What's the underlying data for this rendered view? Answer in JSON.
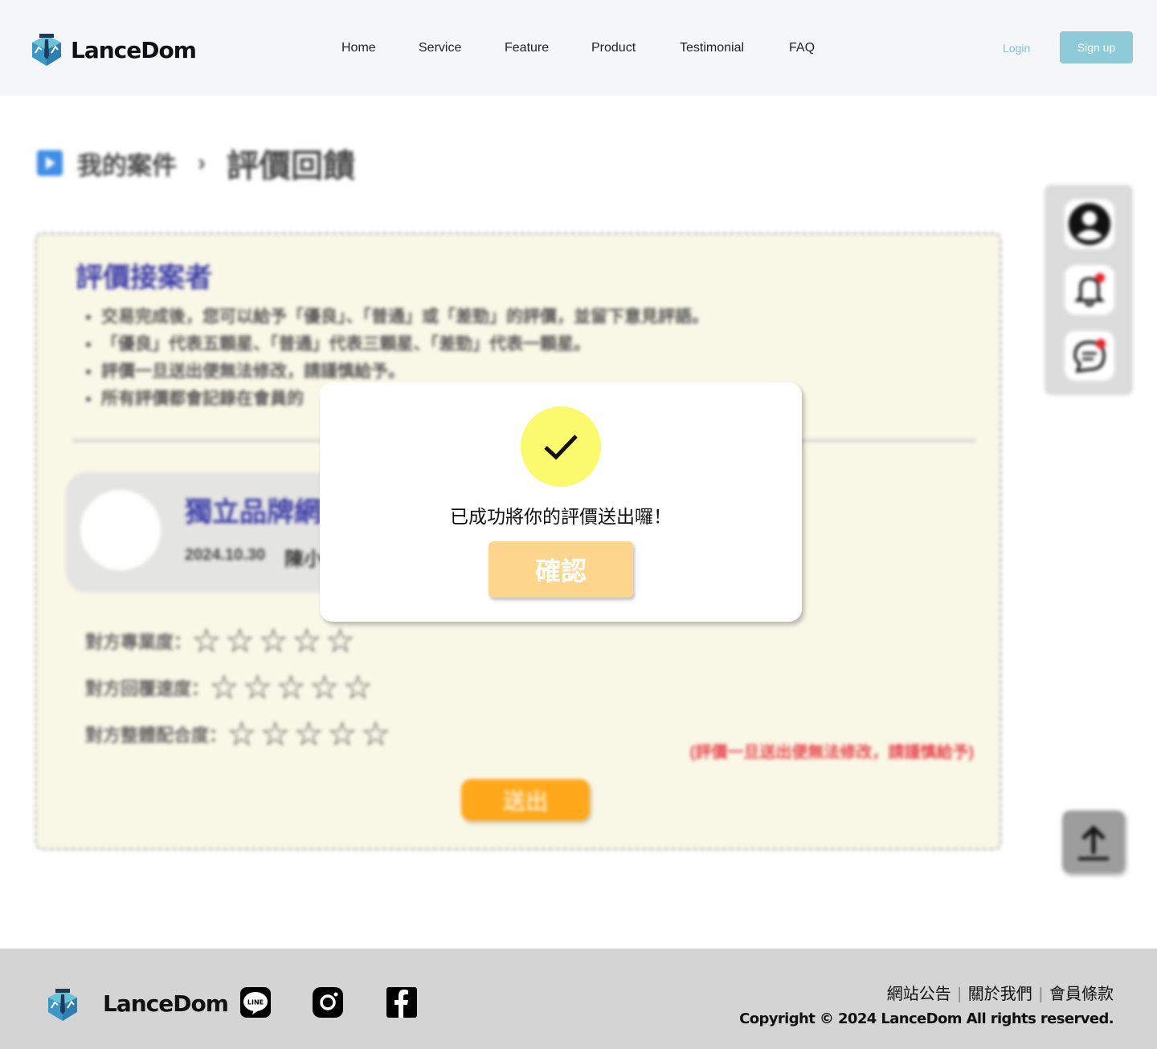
{
  "header": {
    "brand": "LanceDom",
    "nav": [
      "Home",
      "Service",
      "Feature",
      "Product",
      "Testimonial",
      "FAQ"
    ],
    "login_label": "Login",
    "signup_label": "Sign up"
  },
  "breadcrumb": {
    "parent": "我的案件",
    "separator": "›",
    "current": "評價回饋"
  },
  "panel": {
    "title": "評價接案者",
    "rules": [
      "交易完成後，您可以給予「優良」、「普通」或「差勁」的評價，並留下意見評語。",
      "「優良」代表五顆星、「普通」代表三顆星、「差勁」代表一顆星。",
      "評價一旦送出便無法修改，請謹慎給予。",
      "所有評價都會記錄在會員的"
    ],
    "card": {
      "title": "獨立品牌網",
      "date": "2024.10.30",
      "name": "陳小"
    },
    "ratings": [
      {
        "label": "對方專業度：",
        "stars": "☆☆☆☆☆"
      },
      {
        "label": "對方回覆速度：",
        "stars": "☆☆☆☆☆"
      },
      {
        "label": "對方整體配合度：",
        "stars": "☆☆☆☆☆"
      }
    ],
    "warning": "(評價一旦送出便無法修改，請謹慎給予)",
    "submit_label": "送出"
  },
  "side_icons": [
    "user-icon",
    "bell-icon",
    "chat-icon"
  ],
  "modal": {
    "message": "已成功將你的評價送出囉！",
    "confirm_label": "確認"
  },
  "footer": {
    "brand": "LanceDom",
    "links": [
      "網站公告",
      "關於我們",
      "會員條款"
    ],
    "copyright": "Copyright © 2024 LanceDom All rights reserved."
  },
  "colors": {
    "header_bg": "#f5f6fa",
    "signup_bg": "#8ecad8",
    "panel_bg": "#f9f7e6",
    "submit_bg": "#ffa81c",
    "confirm_bg": "#fed58d",
    "check_bg": "#fbfa6f",
    "footer_bg": "#d4d4d4",
    "accent_blue": "#3a3aa8",
    "warning_red": "#e8474f"
  }
}
